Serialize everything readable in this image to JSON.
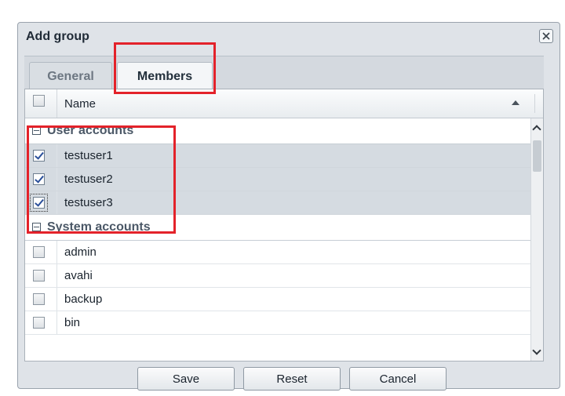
{
  "dialog": {
    "title": "Add group",
    "close_icon": "close-icon"
  },
  "tabs": [
    {
      "label": "General",
      "active": false
    },
    {
      "label": "Members",
      "active": true
    }
  ],
  "grid": {
    "column_name": "Name",
    "sort": "ascending",
    "groups": [
      {
        "title": "User accounts",
        "rows": [
          {
            "name": "testuser1",
            "checked": true
          },
          {
            "name": "testuser2",
            "checked": true
          },
          {
            "name": "testuser3",
            "checked": true
          }
        ]
      },
      {
        "title": "System accounts",
        "rows": [
          {
            "name": "admin",
            "checked": false
          },
          {
            "name": "avahi",
            "checked": false
          },
          {
            "name": "backup",
            "checked": false
          },
          {
            "name": "bin",
            "checked": false
          }
        ]
      }
    ]
  },
  "buttons": {
    "save": "Save",
    "reset": "Reset",
    "cancel": "Cancel"
  },
  "colors": {
    "highlight": "#e3222a",
    "selection": "#d5dbe1",
    "dialog_bg": "#dfe3e8"
  }
}
